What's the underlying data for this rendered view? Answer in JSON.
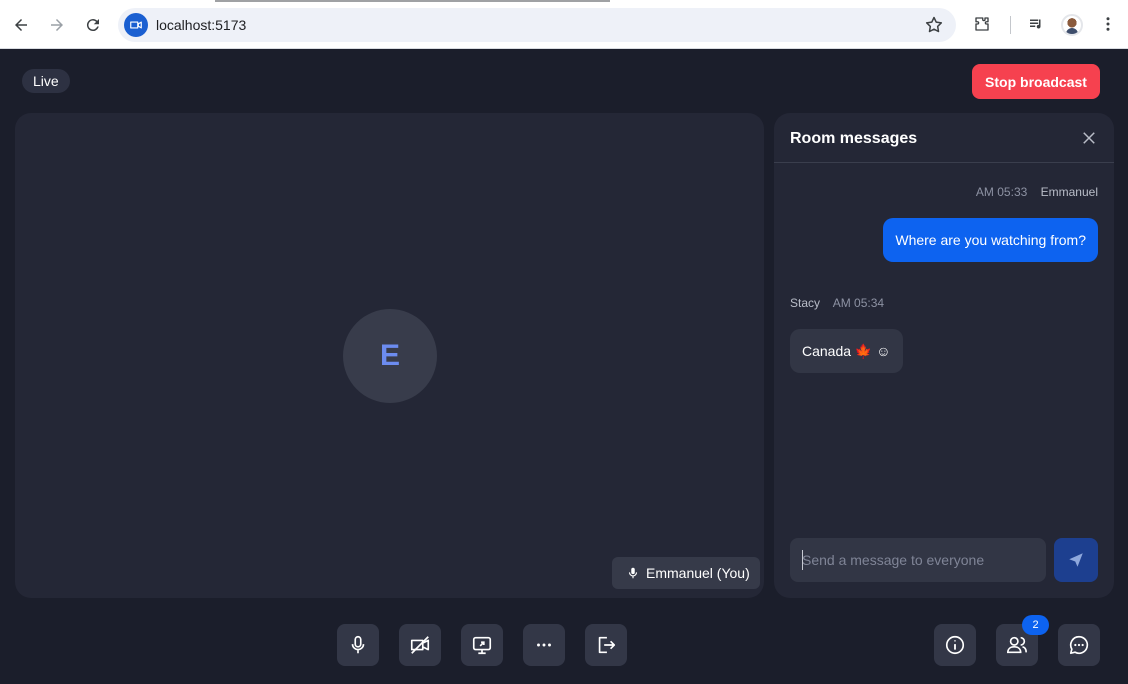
{
  "browser": {
    "url": "localhost:5173"
  },
  "header": {
    "live_label": "Live",
    "stop_label": "Stop broadcast"
  },
  "video": {
    "avatar_initial": "E",
    "name_tag": "Emmanuel (You)"
  },
  "chat": {
    "title": "Room messages",
    "messages": [
      {
        "time": "AM 05:33",
        "sender": "Emmanuel",
        "text": "Where are you watching from?",
        "outgoing": true
      },
      {
        "time": "AM 05:34",
        "sender": "Stacy",
        "text": "Canada 🍁 ☺",
        "outgoing": false
      }
    ],
    "input_placeholder": "Send a message to everyone",
    "input_value": ""
  },
  "controls": {
    "participants_count": "2"
  },
  "colors": {
    "background": "#1b1e2b",
    "panel": "#242736",
    "accent": "#0d63f0",
    "stop": "#f6414f"
  },
  "icons": [
    "back-arrow-icon",
    "forward-arrow-icon",
    "reload-icon",
    "site-video-icon",
    "bookmark-star-icon",
    "extensions-icon",
    "media-controls-icon",
    "more-vert-icon",
    "close-icon",
    "microphone-icon",
    "camera-off-icon",
    "screen-share-icon",
    "more-horizontal-icon",
    "leave-icon",
    "info-icon",
    "participants-icon",
    "chat-icon",
    "send-icon"
  ]
}
